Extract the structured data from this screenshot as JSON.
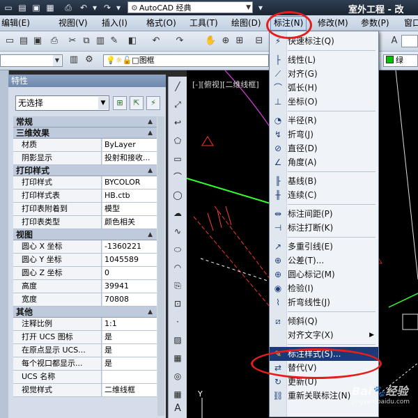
{
  "titlebar": {
    "workspace": "AutoCAD 经典",
    "app_title": "室外工程 - 改"
  },
  "menubar": {
    "items": [
      "编辑(E)",
      "视图(V)",
      "插入(I)",
      "格式(O)",
      "工具(T)",
      "绘图(D)",
      "标注(N)",
      "修改(M)",
      "参数(P)",
      "窗口"
    ],
    "active": "标注(N)"
  },
  "toolbar2": {
    "layer": "图框",
    "color": "绿"
  },
  "properties": {
    "title": "特性",
    "selection": "无选择",
    "sections": [
      {
        "name": "常规",
        "rows": []
      },
      {
        "name": "三维效果",
        "rows": [
          [
            "材质",
            "ByLayer"
          ],
          [
            "阴影显示",
            "投射和接收..."
          ]
        ]
      },
      {
        "name": "打印样式",
        "rows": [
          [
            "打印样式",
            "BYCOLOR"
          ],
          [
            "打印样式表",
            "HB.ctb"
          ],
          [
            "打印表附着到",
            "模型"
          ],
          [
            "打印表类型",
            "颜色相关"
          ]
        ]
      },
      {
        "name": "视图",
        "rows": [
          [
            "圆心 X 坐标",
            "-1360221"
          ],
          [
            "圆心 Y 坐标",
            "1045589"
          ],
          [
            "圆心 Z 坐标",
            "0"
          ],
          [
            "高度",
            "39941"
          ],
          [
            "宽度",
            "70808"
          ]
        ]
      },
      {
        "name": "其他",
        "rows": [
          [
            "注释比例",
            "1:1"
          ],
          [
            "打开 UCS 图标",
            "是"
          ],
          [
            "在原点显示 UCS...",
            "是"
          ],
          [
            "每个视口都显示...",
            "是"
          ],
          [
            "UCS 名称",
            ""
          ],
          [
            "视觉样式",
            "二维线框"
          ]
        ]
      }
    ]
  },
  "canvas": {
    "view_label": "[-][俯视][二维线框]",
    "ucs_label": "Y"
  },
  "dimension_menu": {
    "items": [
      {
        "label": "快速标注(Q)",
        "icon": "quick-dimension-icon"
      },
      {
        "sep": true
      },
      {
        "label": "线性(L)",
        "icon": "linear-icon"
      },
      {
        "label": "对齐(G)",
        "icon": "aligned-icon"
      },
      {
        "label": "弧长(H)",
        "icon": "arc-length-icon"
      },
      {
        "label": "坐标(O)",
        "icon": "ordinate-icon"
      },
      {
        "sep": true
      },
      {
        "label": "半径(R)",
        "icon": "radius-icon"
      },
      {
        "label": "折弯(J)",
        "icon": "jogged-icon"
      },
      {
        "label": "直径(D)",
        "icon": "diameter-icon"
      },
      {
        "label": "角度(A)",
        "icon": "angular-icon"
      },
      {
        "sep": true
      },
      {
        "label": "基线(B)",
        "icon": "baseline-icon"
      },
      {
        "label": "连续(C)",
        "icon": "continue-icon"
      },
      {
        "sep": true
      },
      {
        "label": "标注间距(P)",
        "icon": "dimension-space-icon"
      },
      {
        "label": "标注打断(K)",
        "icon": "dimension-break-icon"
      },
      {
        "sep": true
      },
      {
        "label": "多重引线(E)",
        "icon": "multileader-icon"
      },
      {
        "label": "公差(T)...",
        "icon": "tolerance-icon"
      },
      {
        "label": "圆心标记(M)",
        "icon": "center-mark-icon"
      },
      {
        "label": "检验(I)",
        "icon": "inspection-icon"
      },
      {
        "label": "折弯线性(J)",
        "icon": "jogged-linear-icon"
      },
      {
        "sep": true
      },
      {
        "label": "倾斜(Q)",
        "icon": "oblique-icon"
      },
      {
        "label": "对齐文字(X)",
        "icon": "",
        "submenu": true
      },
      {
        "sep": true
      },
      {
        "label": "标注样式(S)...",
        "icon": "dimension-style-icon",
        "highlighted": true
      },
      {
        "label": "替代(V)",
        "icon": "override-icon"
      },
      {
        "label": "更新(U)",
        "icon": "update-icon"
      },
      {
        "label": "重新关联标注(N)",
        "icon": "reassociate-icon"
      }
    ]
  },
  "watermark": {
    "brand": "Bai",
    "brand2": "经验",
    "url": "jingyan.baidu.com"
  },
  "colors": {
    "highlight": "#1c3a78",
    "annotation": "#e41d1d",
    "canvas": "#000000"
  }
}
